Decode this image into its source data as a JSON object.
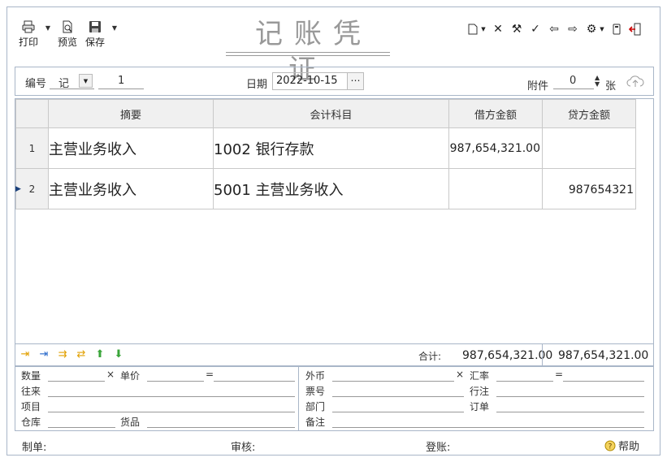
{
  "toolbar": {
    "print_label": "打印",
    "preview_label": "预览",
    "save_label": "保存"
  },
  "title": "记账凭证",
  "header": {
    "number_label": "编号",
    "voucher_type": "记",
    "voucher_number": "1",
    "date_label": "日期",
    "date_value": "2022-10-15",
    "attachment_label": "附件",
    "attachment_count": "0",
    "attachment_unit": "张"
  },
  "table": {
    "columns": [
      "摘要",
      "会计科目",
      "借方金额",
      "贷方金额"
    ],
    "rows": [
      {
        "no": "1",
        "summary": "主营业务收入",
        "account": "1002 银行存款",
        "debit": "987,654,321.00",
        "credit": ""
      },
      {
        "no": "2",
        "summary": "主营业务收入",
        "account": "5001 主营业务收入",
        "debit": "",
        "credit": "987654321"
      }
    ]
  },
  "totals": {
    "label": "合计:",
    "debit": "987,654,321.00",
    "credit": "987,654,321.00"
  },
  "details": {
    "quantity": "数量",
    "times1": "×",
    "unit_price": "单价",
    "equals1": "=",
    "contact": "往来",
    "project": "项目",
    "warehouse": "仓库",
    "goods": "货品",
    "foreign_currency": "外币",
    "times2": "×",
    "exchange_rate": "汇率",
    "equals2": "=",
    "bill_no": "票号",
    "bank_note": "行注",
    "department": "部门",
    "order": "订单",
    "remark": "备注"
  },
  "footer": {
    "prepared_by": "制单:",
    "reviewed_by": "审核:",
    "posted_by": "登账:",
    "help": "帮助"
  },
  "colors": {
    "border": "#a9b6c8",
    "header_bg": "#f0f0f0",
    "title": "#999999",
    "accent_green": "#3aa53a",
    "accent_yellow": "#e2a000",
    "accent_blue": "#2a6acb"
  }
}
